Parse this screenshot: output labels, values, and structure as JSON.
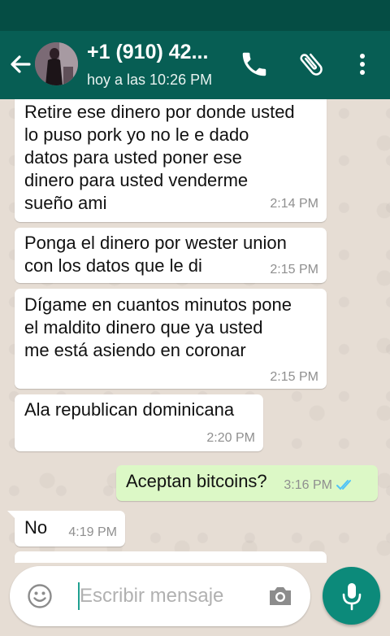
{
  "colors": {
    "status_bar": "#054d44",
    "app_bar": "#075e54",
    "chat_background": "#e6ddd4",
    "bubble_in": "#ffffff",
    "bubble_out": "#dcf8c6",
    "read_ticks": "#4fc3f7",
    "mic_button": "#0c8a7a"
  },
  "header": {
    "contact_name": "+1 (910) 42...",
    "status": "hoy a las 10:26 PM",
    "icons": [
      "back-arrow-icon",
      "contact-avatar",
      "phone-icon",
      "paperclip-icon",
      "more-vert-icon"
    ]
  },
  "messages": [
    {
      "direction": "in",
      "text": "Retire ese dinero por donde usted\nlo puso pork yo no le e dado\ndatos para usted poner ese\ndinero para usted venderme\nsueño ami",
      "time": "2:14 PM"
    },
    {
      "direction": "in",
      "text": "Ponga el dinero por wester union\ncon los datos que le di",
      "time": "2:15 PM"
    },
    {
      "direction": "in",
      "text": "Dígame en cuantos minutos pone\nel maldito dinero que ya usted\nme está asiendo en coronar",
      "time": "2:15 PM"
    },
    {
      "direction": "in",
      "text": "Ala republican dominicana",
      "time": "2:20 PM"
    },
    {
      "direction": "out",
      "text": "Aceptan bitcoins?",
      "time": "3:16 PM",
      "status": "read"
    },
    {
      "direction": "in",
      "text": "No",
      "time": "4:19 PM"
    }
  ],
  "composer": {
    "placeholder": "Escribir mensaje",
    "value": "",
    "icons": [
      "emoji-icon",
      "camera-icon",
      "microphone-icon"
    ]
  }
}
